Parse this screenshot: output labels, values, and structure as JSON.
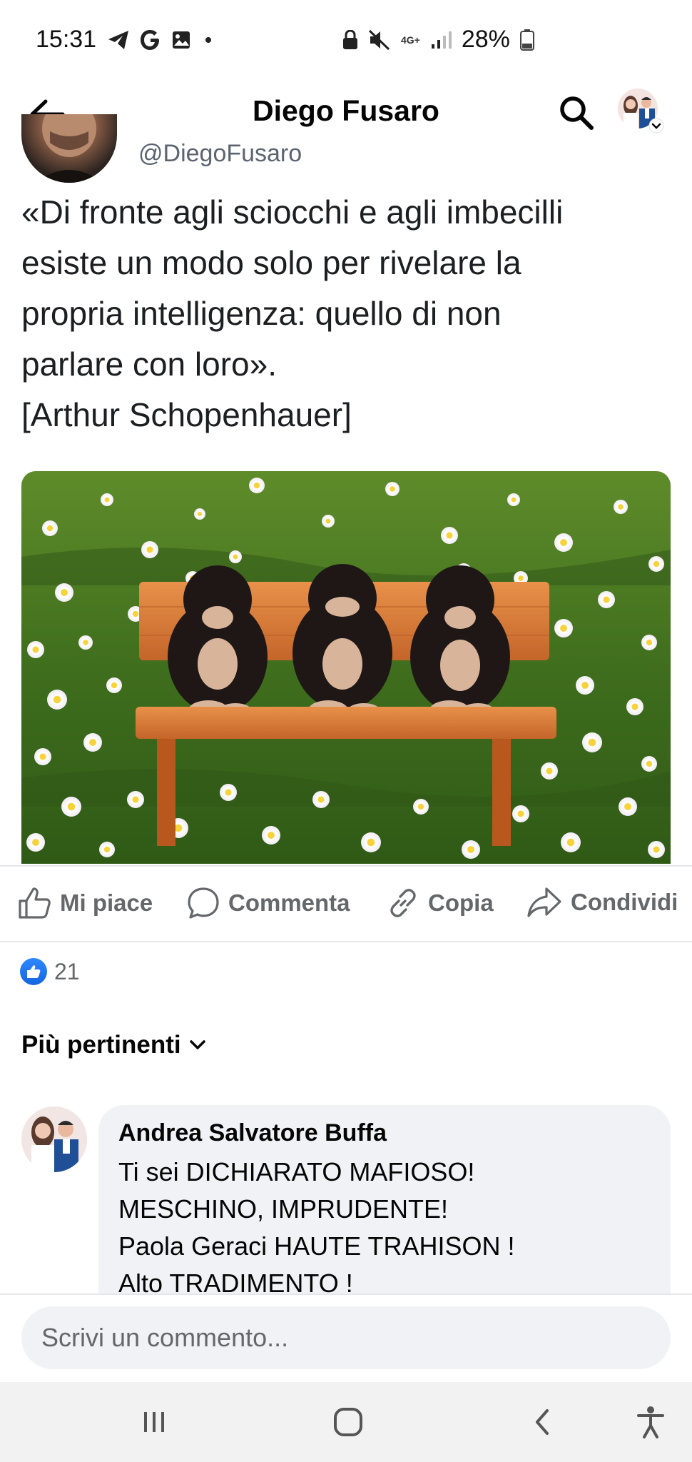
{
  "status_bar": {
    "time": "15:31",
    "network": "4G+",
    "battery": "28%",
    "icons": [
      "telegram-icon",
      "google-icon",
      "gallery-icon",
      "dot-icon",
      "lock-icon",
      "mute-icon",
      "signal-icon",
      "battery-icon"
    ]
  },
  "header": {
    "title": "Diego Fusaro"
  },
  "post": {
    "embedded_handle": "@DiegoFusaro",
    "quote_text": "«Di fronte agli sciocchi e agli imbecilli\nesiste un modo solo per rivelare la\npropria intelligenza: quello di non\nparlare con loro».\n[Arthur Schopenhauer]",
    "image_subject": "three monkeys on wooden bench in daisy meadow"
  },
  "actions": {
    "like_label": "Mi piace",
    "comment_label": "Commenta",
    "copy_label": "Copia",
    "share_label": "Condividi"
  },
  "reactions": {
    "count": "21"
  },
  "comments": {
    "sort_label": "Più pertinenti",
    "items": [
      {
        "author": "Andrea Salvatore Buffa",
        "text": "Ti sei DICHIARATO MAFIOSO!\nMESCHINO, IMPRUDENTE!\nPaola Geraci  HAUTE TRAHISON !\nAlto TRADIMENTO !"
      }
    ]
  },
  "composer": {
    "placeholder": "Scrivi un commento..."
  },
  "colors": {
    "facebook_blue": "#1877f2",
    "muted_text": "#65676b",
    "bubble_bg": "#f0f2f5"
  }
}
